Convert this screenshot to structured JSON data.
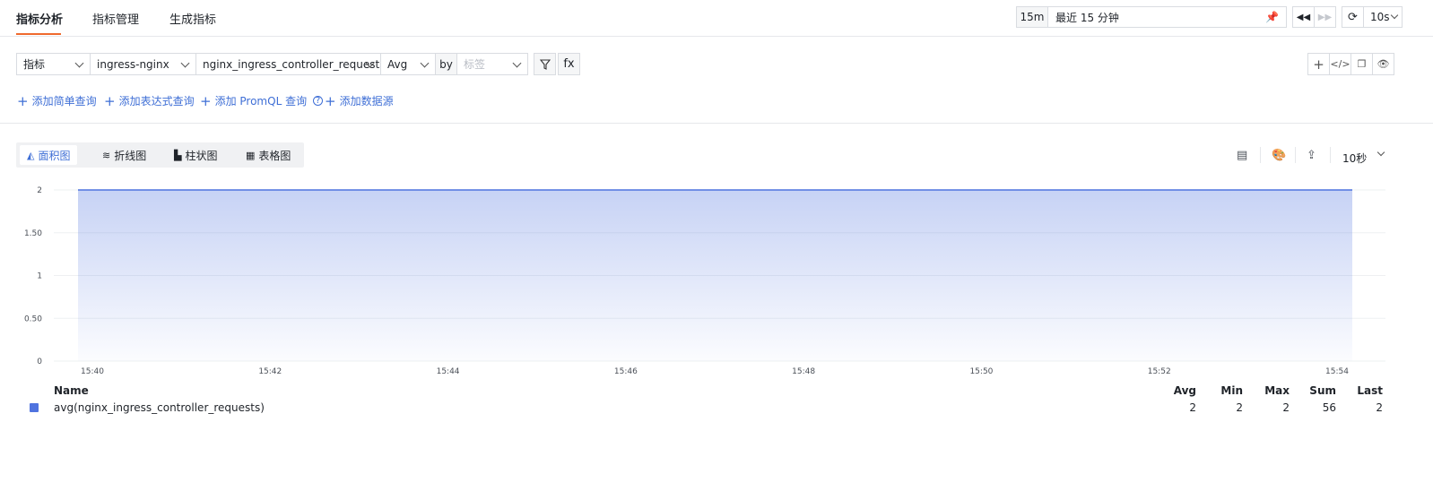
{
  "tabs": [
    {
      "label": "指标分析",
      "active": true
    },
    {
      "label": "指标管理",
      "active": false
    },
    {
      "label": "生成指标",
      "active": false
    }
  ],
  "time": {
    "preset": "15m",
    "range_label": "最近 15 分钟",
    "refresh_interval": "10s"
  },
  "query": {
    "type_label": "指标",
    "datasource": "ingress-nginx",
    "metric": "nginx_ingress_controller_requests",
    "aggregation": "Avg",
    "by_label": "by",
    "group_placeholder": "标签",
    "fx_label": "fx"
  },
  "add_links": [
    {
      "label": "添加简单查询"
    },
    {
      "label": "添加表达式查询"
    },
    {
      "label": "添加 PromQL 查询"
    },
    {
      "label": "添加数据源"
    }
  ],
  "chart_tabs": [
    {
      "label": "面积图",
      "active": true
    },
    {
      "label": "折线图",
      "active": false
    },
    {
      "label": "柱状图",
      "active": false
    },
    {
      "label": "表格图",
      "active": false
    }
  ],
  "step_label": "10秒",
  "colors": {
    "accent": "#3f6fd6",
    "series": "#4f73df",
    "tab_underline": "#ef6a2e"
  },
  "chart_data": {
    "type": "area",
    "x": [
      "15:40",
      "15:42",
      "15:44",
      "15:46",
      "15:48",
      "15:50",
      "15:52",
      "15:54"
    ],
    "yticks": [
      "0",
      "0.50",
      "1",
      "1.50",
      "2"
    ],
    "ylim": [
      0,
      2
    ],
    "grid": true,
    "series": [
      {
        "name": "avg(nginx_ingress_controller_requests)",
        "values": [
          2,
          2,
          2,
          2,
          2,
          2,
          2,
          2
        ]
      }
    ]
  },
  "legend": {
    "headers": {
      "name": "Name",
      "avg": "Avg",
      "min": "Min",
      "max": "Max",
      "sum": "Sum",
      "last": "Last"
    },
    "row": {
      "name": "avg(nginx_ingress_controller_requests)",
      "avg": "2",
      "min": "2",
      "max": "2",
      "sum": "56",
      "last": "2"
    }
  }
}
